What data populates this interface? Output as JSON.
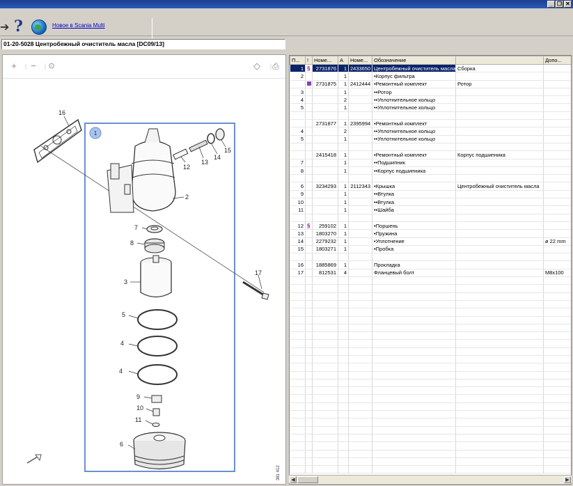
{
  "toolbar": {
    "link_label": "Новое в Scania Multi"
  },
  "path": {
    "title": "01-20-5028 Центробежный очиститель масла [DC09/13]"
  },
  "drawing": {
    "group_label": "1",
    "side_code": "381 412",
    "labels": [
      "16",
      "12",
      "13",
      "14",
      "15",
      "2",
      "7",
      "8",
      "3",
      "17",
      "5",
      "4",
      "4",
      "9",
      "10",
      "11",
      "6"
    ]
  },
  "table": {
    "headers": [
      "П...",
      "!",
      "Номе...",
      "А",
      "Номе...",
      "Обозначение",
      "",
      "Допо..."
    ],
    "rows": [
      {
        "pos": "1",
        "mark": "§",
        "art": "2731876",
        "qty": "1",
        "ref": "2433650",
        "desc": "Центробежный очиститель масла",
        "note": "Сборка",
        "extra": "",
        "sel": true
      },
      {
        "pos": "2",
        "mark": "",
        "art": "",
        "qty": "1",
        "ref": "",
        "desc": "•Корпус фильтра",
        "note": "",
        "extra": ""
      },
      {
        "pos": "",
        "mark": "p",
        "art": "2731875",
        "qty": "1",
        "ref": "2412444",
        "desc": "•Ремонтный комплект",
        "note": "Ротор",
        "extra": ""
      },
      {
        "pos": "3",
        "mark": "",
        "art": "",
        "qty": "1",
        "ref": "",
        "desc": "••Ротор",
        "note": "",
        "extra": ""
      },
      {
        "pos": "4",
        "mark": "",
        "art": "",
        "qty": "2",
        "ref": "",
        "desc": "••Уплотнительное кольцо",
        "note": "",
        "extra": ""
      },
      {
        "pos": "5",
        "mark": "",
        "art": "",
        "qty": "1",
        "ref": "",
        "desc": "••Уплотнительное кольцо",
        "note": "",
        "extra": ""
      },
      {
        "pos": "",
        "mark": "",
        "art": "",
        "qty": "",
        "ref": "",
        "desc": "",
        "note": "",
        "extra": ""
      },
      {
        "pos": "",
        "mark": "",
        "art": "2731877",
        "qty": "1",
        "ref": "2395994",
        "desc": "•Ремонтный комплект",
        "note": "",
        "extra": ""
      },
      {
        "pos": "4",
        "mark": "",
        "art": "",
        "qty": "2",
        "ref": "",
        "desc": "••Уплотнительное кольцо",
        "note": "",
        "extra": ""
      },
      {
        "pos": "5",
        "mark": "",
        "art": "",
        "qty": "1",
        "ref": "",
        "desc": "••Уплотнительное кольцо",
        "note": "",
        "extra": ""
      },
      {
        "pos": "",
        "mark": "",
        "art": "",
        "qty": "",
        "ref": "",
        "desc": "",
        "note": "",
        "extra": ""
      },
      {
        "pos": "",
        "mark": "",
        "art": "2415418",
        "qty": "1",
        "ref": "",
        "desc": "•Ремонтный комплект",
        "note": "Корпус подшипника",
        "extra": ""
      },
      {
        "pos": "7",
        "mark": "",
        "art": "",
        "qty": "1",
        "ref": "",
        "desc": "••Подшипник",
        "note": "",
        "extra": ""
      },
      {
        "pos": "8",
        "mark": "",
        "art": "",
        "qty": "1",
        "ref": "",
        "desc": "••Корпус подшипника",
        "note": "",
        "extra": ""
      },
      {
        "pos": "",
        "mark": "",
        "art": "",
        "qty": "",
        "ref": "",
        "desc": "",
        "note": "",
        "extra": ""
      },
      {
        "pos": "6",
        "mark": "",
        "art": "3234293",
        "qty": "1",
        "ref": "2112343",
        "desc": "•Крышка",
        "note": "Центробежный очиститель масла",
        "extra": ""
      },
      {
        "pos": "9",
        "mark": "",
        "art": "",
        "qty": "1",
        "ref": "",
        "desc": "••Втулка",
        "note": "",
        "extra": ""
      },
      {
        "pos": "10",
        "mark": "",
        "art": "",
        "qty": "1",
        "ref": "",
        "desc": "••Втулка",
        "note": "",
        "extra": ""
      },
      {
        "pos": "11",
        "mark": "",
        "art": "",
        "qty": "1",
        "ref": "",
        "desc": "••Шайба",
        "note": "",
        "extra": ""
      },
      {
        "pos": "",
        "mark": "",
        "art": "",
        "qty": "",
        "ref": "",
        "desc": "",
        "note": "",
        "extra": ""
      },
      {
        "pos": "12",
        "mark": "§",
        "art": "259102",
        "qty": "1",
        "ref": "",
        "desc": "•Поршень",
        "note": "",
        "extra": ""
      },
      {
        "pos": "13",
        "mark": "",
        "art": "1803270",
        "qty": "1",
        "ref": "",
        "desc": "•Пружина",
        "note": "",
        "extra": ""
      },
      {
        "pos": "14",
        "mark": "",
        "art": "2279232",
        "qty": "1",
        "ref": "",
        "desc": "•Уплотнение",
        "note": "",
        "extra": "ø 22 mm"
      },
      {
        "pos": "15",
        "mark": "",
        "art": "1803271",
        "qty": "1",
        "ref": "",
        "desc": "•Пробка",
        "note": "",
        "extra": ""
      },
      {
        "pos": "",
        "mark": "",
        "art": "",
        "qty": "",
        "ref": "",
        "desc": "",
        "note": "",
        "extra": ""
      },
      {
        "pos": "16",
        "mark": "",
        "art": "1885869",
        "qty": "1",
        "ref": "",
        "desc": "Прокладка",
        "note": "",
        "extra": ""
      },
      {
        "pos": "17",
        "mark": "",
        "art": "812531",
        "qty": "4",
        "ref": "",
        "desc": "Фланцевый болт",
        "note": "",
        "extra": "M8x100"
      }
    ],
    "empty_rows": 25
  }
}
